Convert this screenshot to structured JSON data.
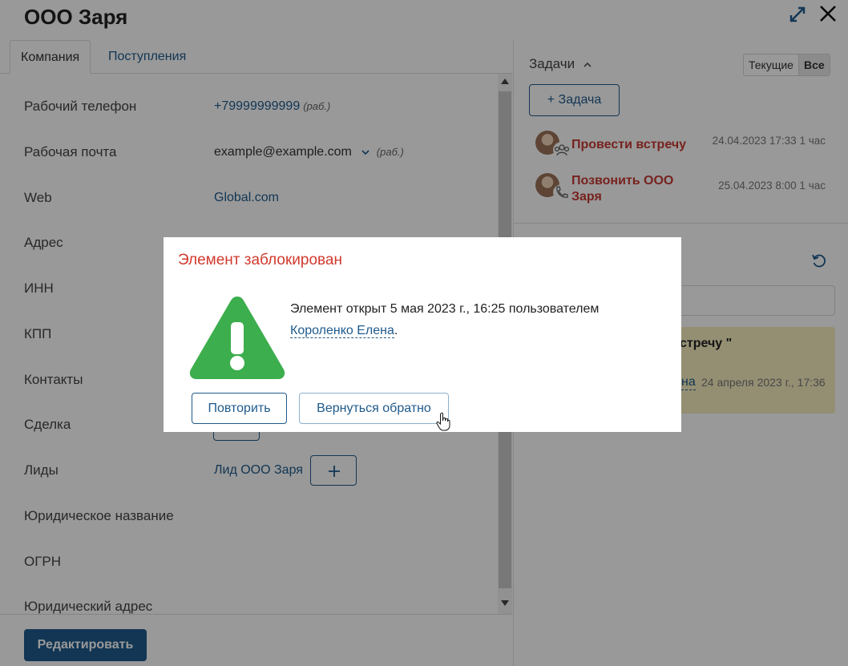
{
  "header": {
    "title": "ООО Заря"
  },
  "tabs": [
    {
      "label": "Компания"
    },
    {
      "label": "Поступления"
    }
  ],
  "fields": {
    "phone": {
      "label": "Рабочий телефон",
      "value": "+79999999999",
      "note": "(раб.)"
    },
    "email": {
      "label": "Рабочая почта",
      "value": "example@example.com",
      "note": "(раб.)"
    },
    "web": {
      "label": "Web",
      "value": "Global.com"
    },
    "address": {
      "label": "Адрес"
    },
    "inn": {
      "label": "ИНН"
    },
    "kpp": {
      "label": "КПП"
    },
    "contacts": {
      "label": "Контакты"
    },
    "deal": {
      "label": "Сделка"
    },
    "leads": {
      "label": "Лиды",
      "value": "Лид ООО Заря"
    },
    "legal_name": {
      "label": "Юридическое название"
    },
    "ogrn": {
      "label": "ОГРН"
    },
    "legal_address": {
      "label": "Юридический адрес"
    }
  },
  "footer": {
    "edit_label": "Редактировать"
  },
  "tasks": {
    "title": "Задачи",
    "filter_current": "Текущие",
    "filter_all": "Все",
    "add_label": "+ Задача",
    "items": [
      {
        "name": "Провести встречу",
        "date": "24.04.2023 17:33 1 час",
        "type_icon": "group-icon"
      },
      {
        "name": "Позвонить ООО Заря",
        "date": "25.04.2023 8:00 1 час",
        "type_icon": "phone-icon"
      }
    ]
  },
  "feed": {
    "note_title_fragment": "стречу \"",
    "note_link_fragment": "на",
    "note_date": "24 апреля 2023 г., 17:36"
  },
  "dialog": {
    "title": "Элемент заблокирован",
    "message": "Элемент открыт 5 мая 2023 г., 16:25 пользователем",
    "user": "Короленко Елена",
    "message_end": ".",
    "retry_label": "Повторить",
    "back_label": "Вернуться обратно"
  },
  "colors": {
    "accent": "#1e5a8c",
    "danger": "#d13a2f",
    "warning_icon": "#3cae4d",
    "note_bg": "#f7eec0"
  }
}
